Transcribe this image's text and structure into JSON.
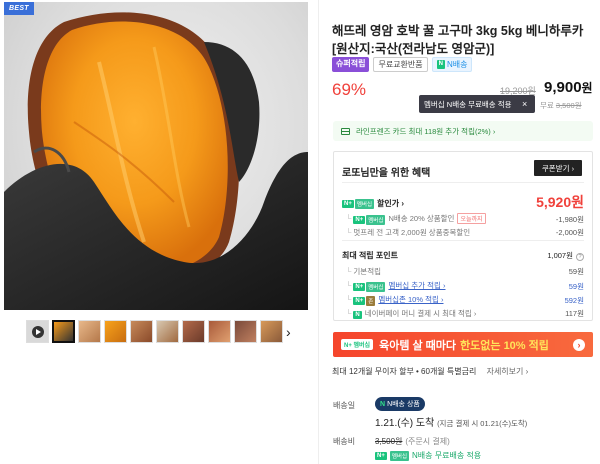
{
  "gallery": {
    "badge": "BEST",
    "thumb_count": 10,
    "next_label": "›"
  },
  "product": {
    "title": "해뜨레 영암 호박 꿀 고구마 3kg 5kg 베니하루카 [원산지:국산(전라남도 영암군)]",
    "tags": {
      "super": "슈퍼적립",
      "free_exchange": "무료교환반품",
      "n_delivery": "N배송"
    },
    "discount_rate": "69%",
    "original_price": "19,200원",
    "sale_price": "9,900",
    "sale_price_unit": "원",
    "tooltip": "멤버십 N배송 무료배송 적용",
    "tooltip_close": "×",
    "shipping_note_prefix": "무료",
    "shipping_note_struck": "3,500원",
    "card_banner": "라인프렌즈 카드 최대 118원 추가 적립(2%) ›"
  },
  "benefits": {
    "title": "로또님만을 위한 혜택",
    "coupon_button": "쿠폰받기 ›",
    "sale_label": "할인가 ›",
    "sale_value": "5,920원",
    "discounts": [
      {
        "label": "N배송 20% 상품할인",
        "tag": "오늘까지",
        "value": "-1,980원"
      },
      {
        "label": "멋프레 전 고객 2,000원 상품중복할인",
        "value": "-2,000원"
      }
    ],
    "points_label": "최대 적립 포인트",
    "points_value": "1,007원",
    "points": [
      {
        "label": "기본적립",
        "value": "59원"
      },
      {
        "label": "멤버십 추가 적립 ›",
        "value": "59원"
      },
      {
        "label": "멤버십존 10% 적립 ›",
        "value": "592원"
      },
      {
        "label": "네이버페이 머니 결제 시 최대 적립 ›",
        "value": "117원"
      }
    ]
  },
  "promo_banner": {
    "badge": "N+ 멤버십",
    "text": "육아템 살 때마다",
    "highlight": "한도없는 10% 적립",
    "chevron": "›"
  },
  "installment": {
    "text": "최대 12개월 무이자 할부 • 60개월 특별금리",
    "more": "자세히보기 ›"
  },
  "delivery": {
    "label": "배송일",
    "badge": "N배송 상품",
    "date": "1.21.(수) 도착",
    "date_detail": "(지금 결제 시 01.21(수)도착)",
    "fee_label": "배송비",
    "fee_struck": "3,500원",
    "fee_note": "(주문시 결제)",
    "n_free": "N배송 무료배송 적용"
  },
  "colors": {
    "accent_red": "#f0413b",
    "naver_green": "#19c37d",
    "purple": "#8a4fd8"
  }
}
